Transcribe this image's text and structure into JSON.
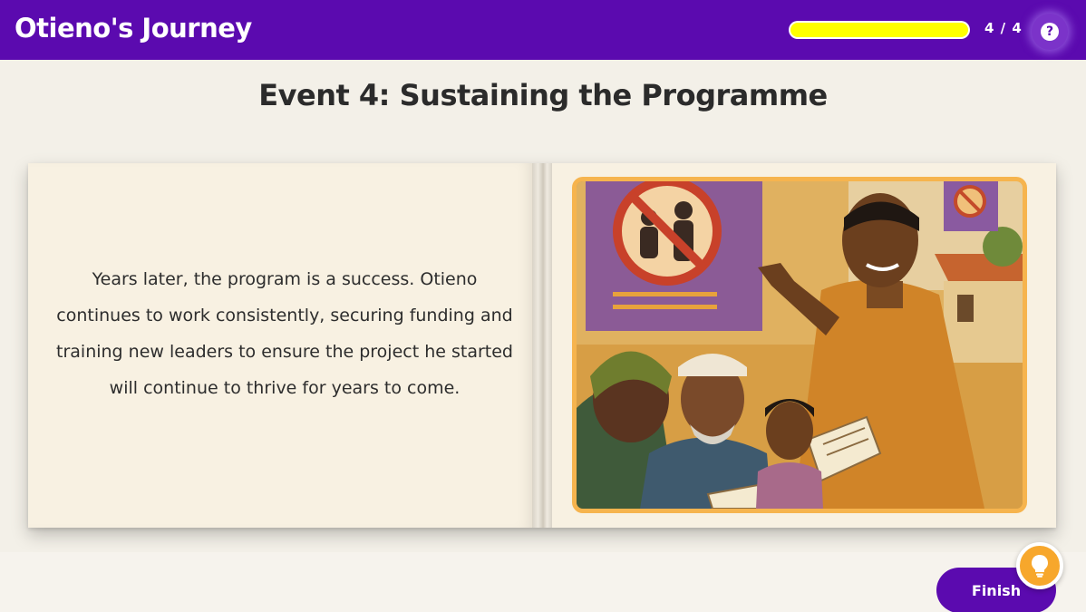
{
  "header": {
    "title": "Otieno's Journey",
    "progress_text": "4 / 4",
    "progress_fraction": 1.0,
    "help_icon": "question-circle-icon",
    "help_glyph": "?"
  },
  "event": {
    "title": "Event 4: Sustaining the Programme",
    "text": "Years later, the program is a success. Otieno continues to work consistently, securing funding and training new leaders to ensure the project he started will continue to thrive for years to come."
  },
  "illustration": {
    "subject": "community-leader-presenting-illustration"
  },
  "footer": {
    "finish_label": "Finish",
    "hint_icon": "lightbulb-icon"
  },
  "colors": {
    "primary": "#5b0aaf",
    "progress": "#ffff00",
    "accent": "#f7a72c",
    "background": "#f3f0e8",
    "page": "#f8f1e2"
  }
}
